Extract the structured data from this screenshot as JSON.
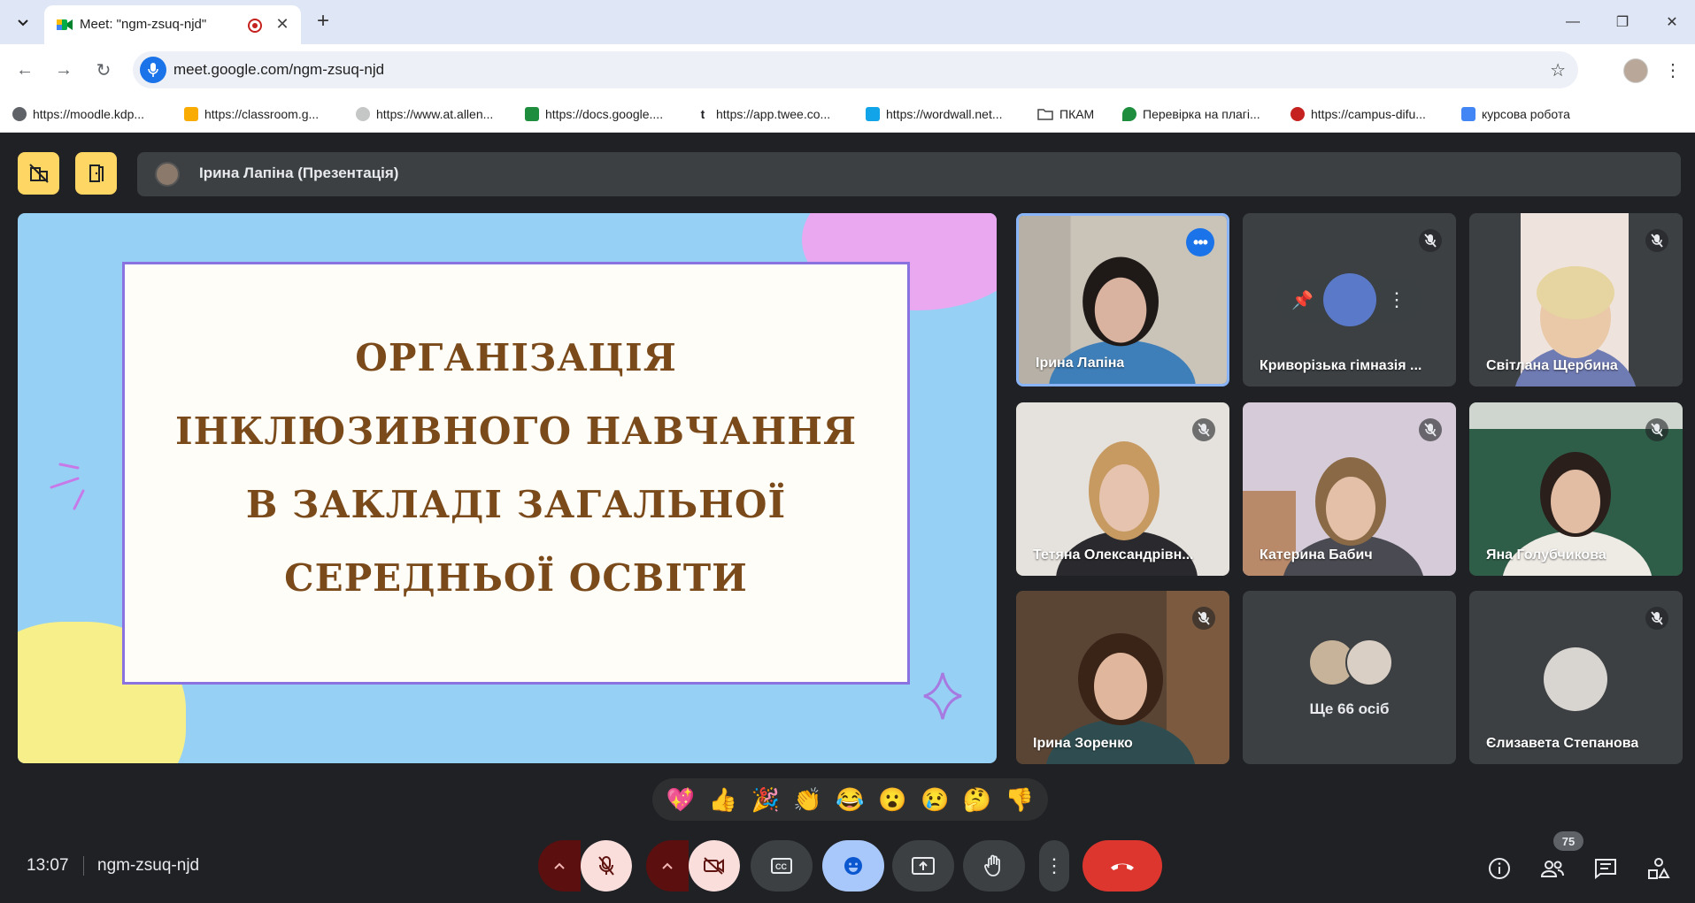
{
  "browser": {
    "tab": {
      "title": "Meet: \"ngm-zsuq-njd\""
    },
    "url": "meet.google.com/ngm-zsuq-njd",
    "bookmarks": [
      {
        "label": "https://moodle.kdp...",
        "icon": "moodle-icon",
        "color": "#5f6368"
      },
      {
        "label": "https://classroom.g...",
        "icon": "classroom-icon",
        "color": "#f9ab00"
      },
      {
        "label": "https://www.at.allen...",
        "icon": "allen-icon",
        "color": "#9aa0a6"
      },
      {
        "label": "https://docs.google....",
        "icon": "sheets-icon",
        "color": "#1e8e3e"
      },
      {
        "label": "https://app.twee.co...",
        "icon": "twee-icon",
        "color": "#202124"
      },
      {
        "label": "https://wordwall.net...",
        "icon": "wordwall-icon",
        "color": "#12a4e8"
      },
      {
        "label": "ПКАМ",
        "icon": "folder-icon",
        "color": "#5f6368"
      },
      {
        "label": "Перевірка на плагі...",
        "icon": "plagiarism-icon",
        "color": "#1e8e3e"
      },
      {
        "label": "https://campus-difu...",
        "icon": "campus-icon",
        "color": "#c5221f"
      },
      {
        "label": "курсова робота",
        "icon": "docs-icon",
        "color": "#4285f4"
      }
    ]
  },
  "meet": {
    "presenter_label": "Ірина Лапіна (Презентація)",
    "slide": {
      "lines": [
        "ОРГАНІЗАЦІЯ",
        "ІНКЛЮЗИВНОГО НАВЧАННЯ",
        "В ЗАКЛАДІ ЗАГАЛЬНОЇ",
        "СЕРЕДНЬОЇ ОСВІТИ"
      ]
    },
    "participants": [
      {
        "name": "Ірина Лапіна"
      },
      {
        "name": "Криворізька гімназія ..."
      },
      {
        "name": "Світлана Щербина"
      },
      {
        "name": "Тетяна Олександрівн..."
      },
      {
        "name": "Катерина Бабич"
      },
      {
        "name": "Яна Голубчикова"
      },
      {
        "name": "Ірина Зоренко"
      },
      {
        "name": "Єлизавета Степанова"
      }
    ],
    "more_people": "Ще 66 осіб",
    "reactions": [
      "💖",
      "👍",
      "🎉",
      "👏",
      "😂",
      "😮",
      "😢",
      "🤔",
      "👎"
    ],
    "time": "13:07",
    "meeting_code": "ngm-zsuq-njd",
    "people_count": "75"
  },
  "colors": {
    "accent": "#1a73e8",
    "hangup": "#dc362e",
    "highlight": "#fdd663",
    "slide_title": "#7a4a1b"
  }
}
